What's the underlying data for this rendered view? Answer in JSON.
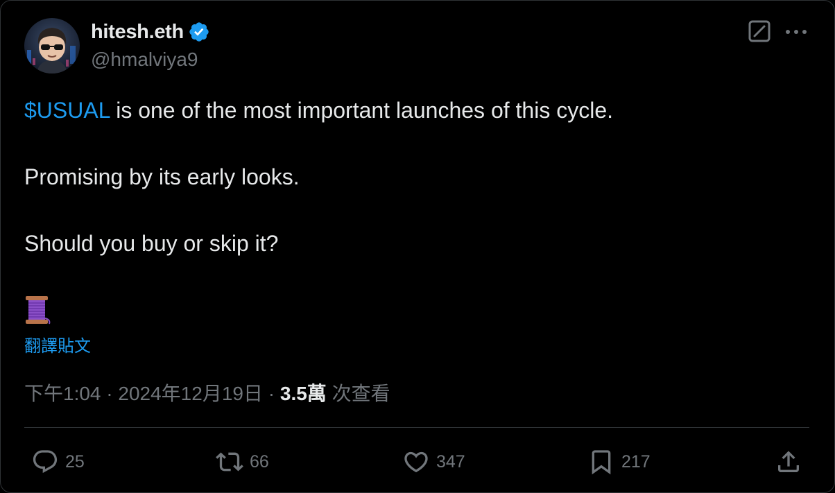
{
  "author": {
    "display_name": "hitesh.eth",
    "handle": "@hmalviya9",
    "verified": true
  },
  "tweet": {
    "cashtag": "$USUAL",
    "line1_rest": " is one of the most important launches of this cycle.",
    "line2": "Promising by its early looks.",
    "line3": "Should you buy or skip it?",
    "emoji": "thread-spool-icon",
    "translate_label": "翻譯貼文"
  },
  "meta": {
    "time": "下午1:04",
    "separator1": " · ",
    "date": "2024年12月19日",
    "separator2": " · ",
    "views_count": "3.5萬",
    "views_label": " 次查看"
  },
  "actions": {
    "replies": "25",
    "reposts": "66",
    "likes": "347",
    "bookmarks": "217"
  },
  "colors": {
    "background": "#000000",
    "text": "#e7e9ea",
    "muted": "#71767b",
    "accent": "#1d9bf0",
    "border": "#2f3336"
  }
}
